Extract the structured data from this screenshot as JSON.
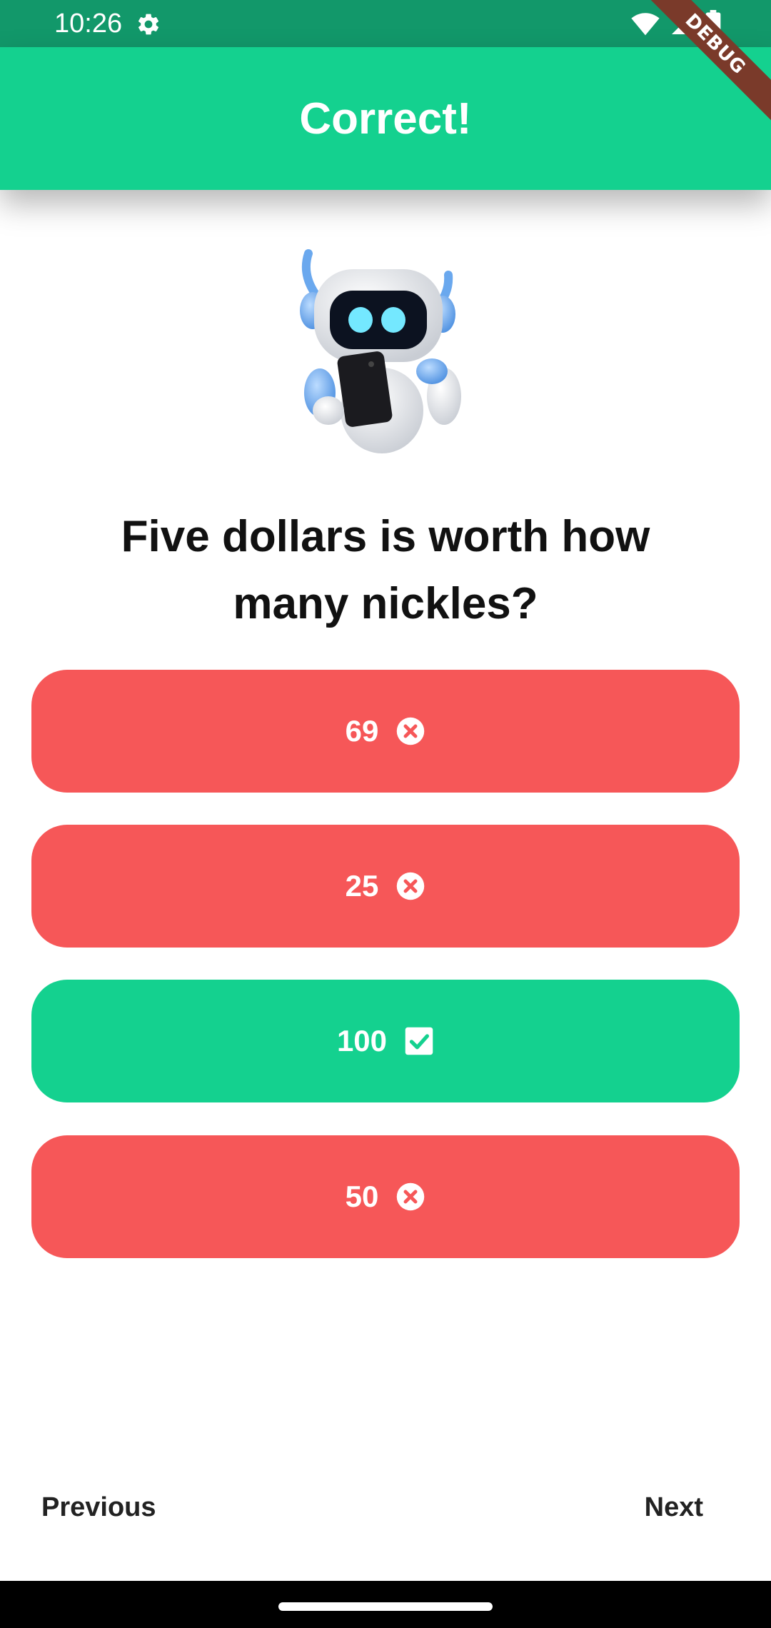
{
  "status_bar": {
    "time": "10:26",
    "icons": [
      "gear-icon",
      "wifi-icon",
      "signal-icon",
      "battery-icon"
    ]
  },
  "debug_banner": "DEBUG",
  "app_bar": {
    "title": "Correct!",
    "color": "#14d18f"
  },
  "illustration": "robot-holding-phone",
  "question": "Five dollars is worth how many nickles?",
  "answers": [
    {
      "label": "69",
      "status": "wrong",
      "icon": "cancel-icon"
    },
    {
      "label": "25",
      "status": "wrong",
      "icon": "cancel-icon"
    },
    {
      "label": "100",
      "status": "correct",
      "icon": "check-box-icon"
    },
    {
      "label": "50",
      "status": "wrong",
      "icon": "cancel-icon"
    }
  ],
  "colors": {
    "wrong": "#f65758",
    "correct": "#14d18f",
    "status_bar": "#12986a"
  },
  "nav": {
    "previous": "Previous",
    "next": "Next"
  }
}
